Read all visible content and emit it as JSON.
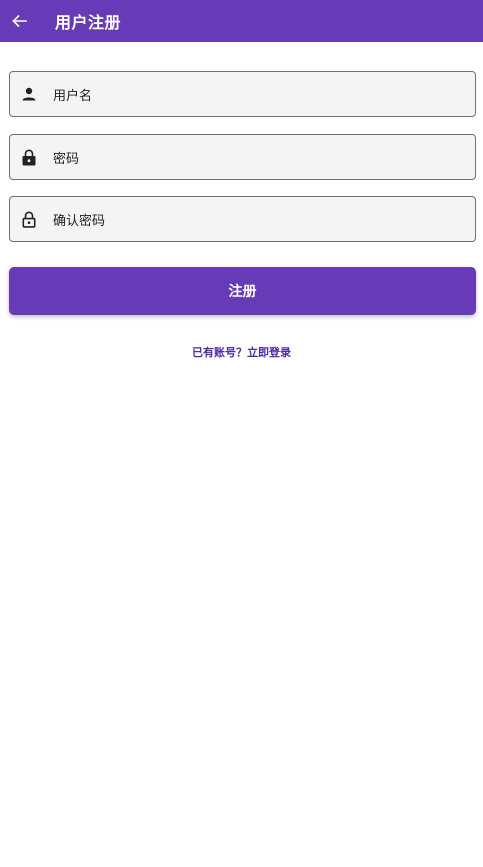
{
  "appbar": {
    "back_icon": "arrow-left-icon",
    "title": "用户注册",
    "color": "#673AB7"
  },
  "form": {
    "username": {
      "icon": "person-icon",
      "placeholder": "用户名",
      "value": ""
    },
    "password": {
      "icon": "lock-icon",
      "placeholder": "密码",
      "value": ""
    },
    "confirm_password": {
      "icon": "lock-outline-icon",
      "placeholder": "确认密码",
      "value": ""
    }
  },
  "register_button": {
    "label": "注册"
  },
  "login_link": {
    "label": "已有账号？立即登录"
  }
}
